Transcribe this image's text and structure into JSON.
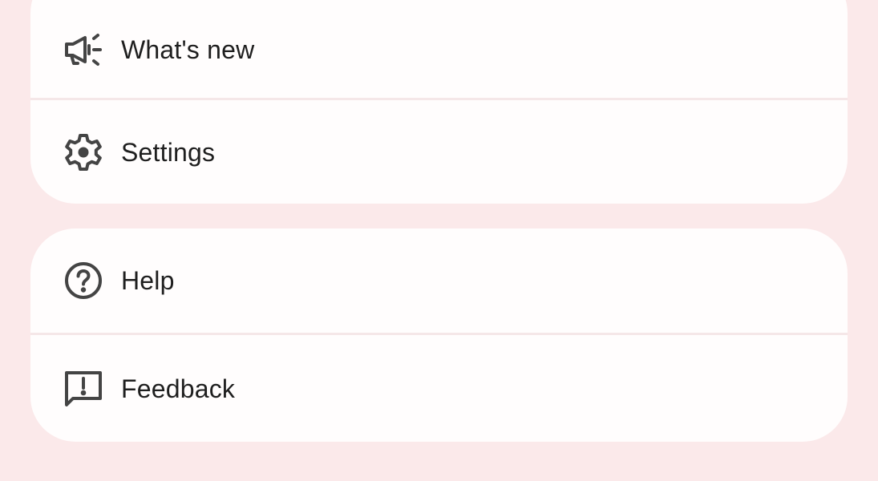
{
  "menu": {
    "group1": {
      "items": [
        {
          "label": "What's new",
          "icon": "megaphone-icon"
        },
        {
          "label": "Settings",
          "icon": "gear-icon"
        }
      ]
    },
    "group2": {
      "items": [
        {
          "label": "Help",
          "icon": "help-circle-icon"
        },
        {
          "label": "Feedback",
          "icon": "feedback-icon"
        }
      ]
    }
  },
  "colors": {
    "background": "#fbe9ea",
    "card": "#fffdfd",
    "text": "#1f1f1f",
    "icon": "#444444"
  }
}
